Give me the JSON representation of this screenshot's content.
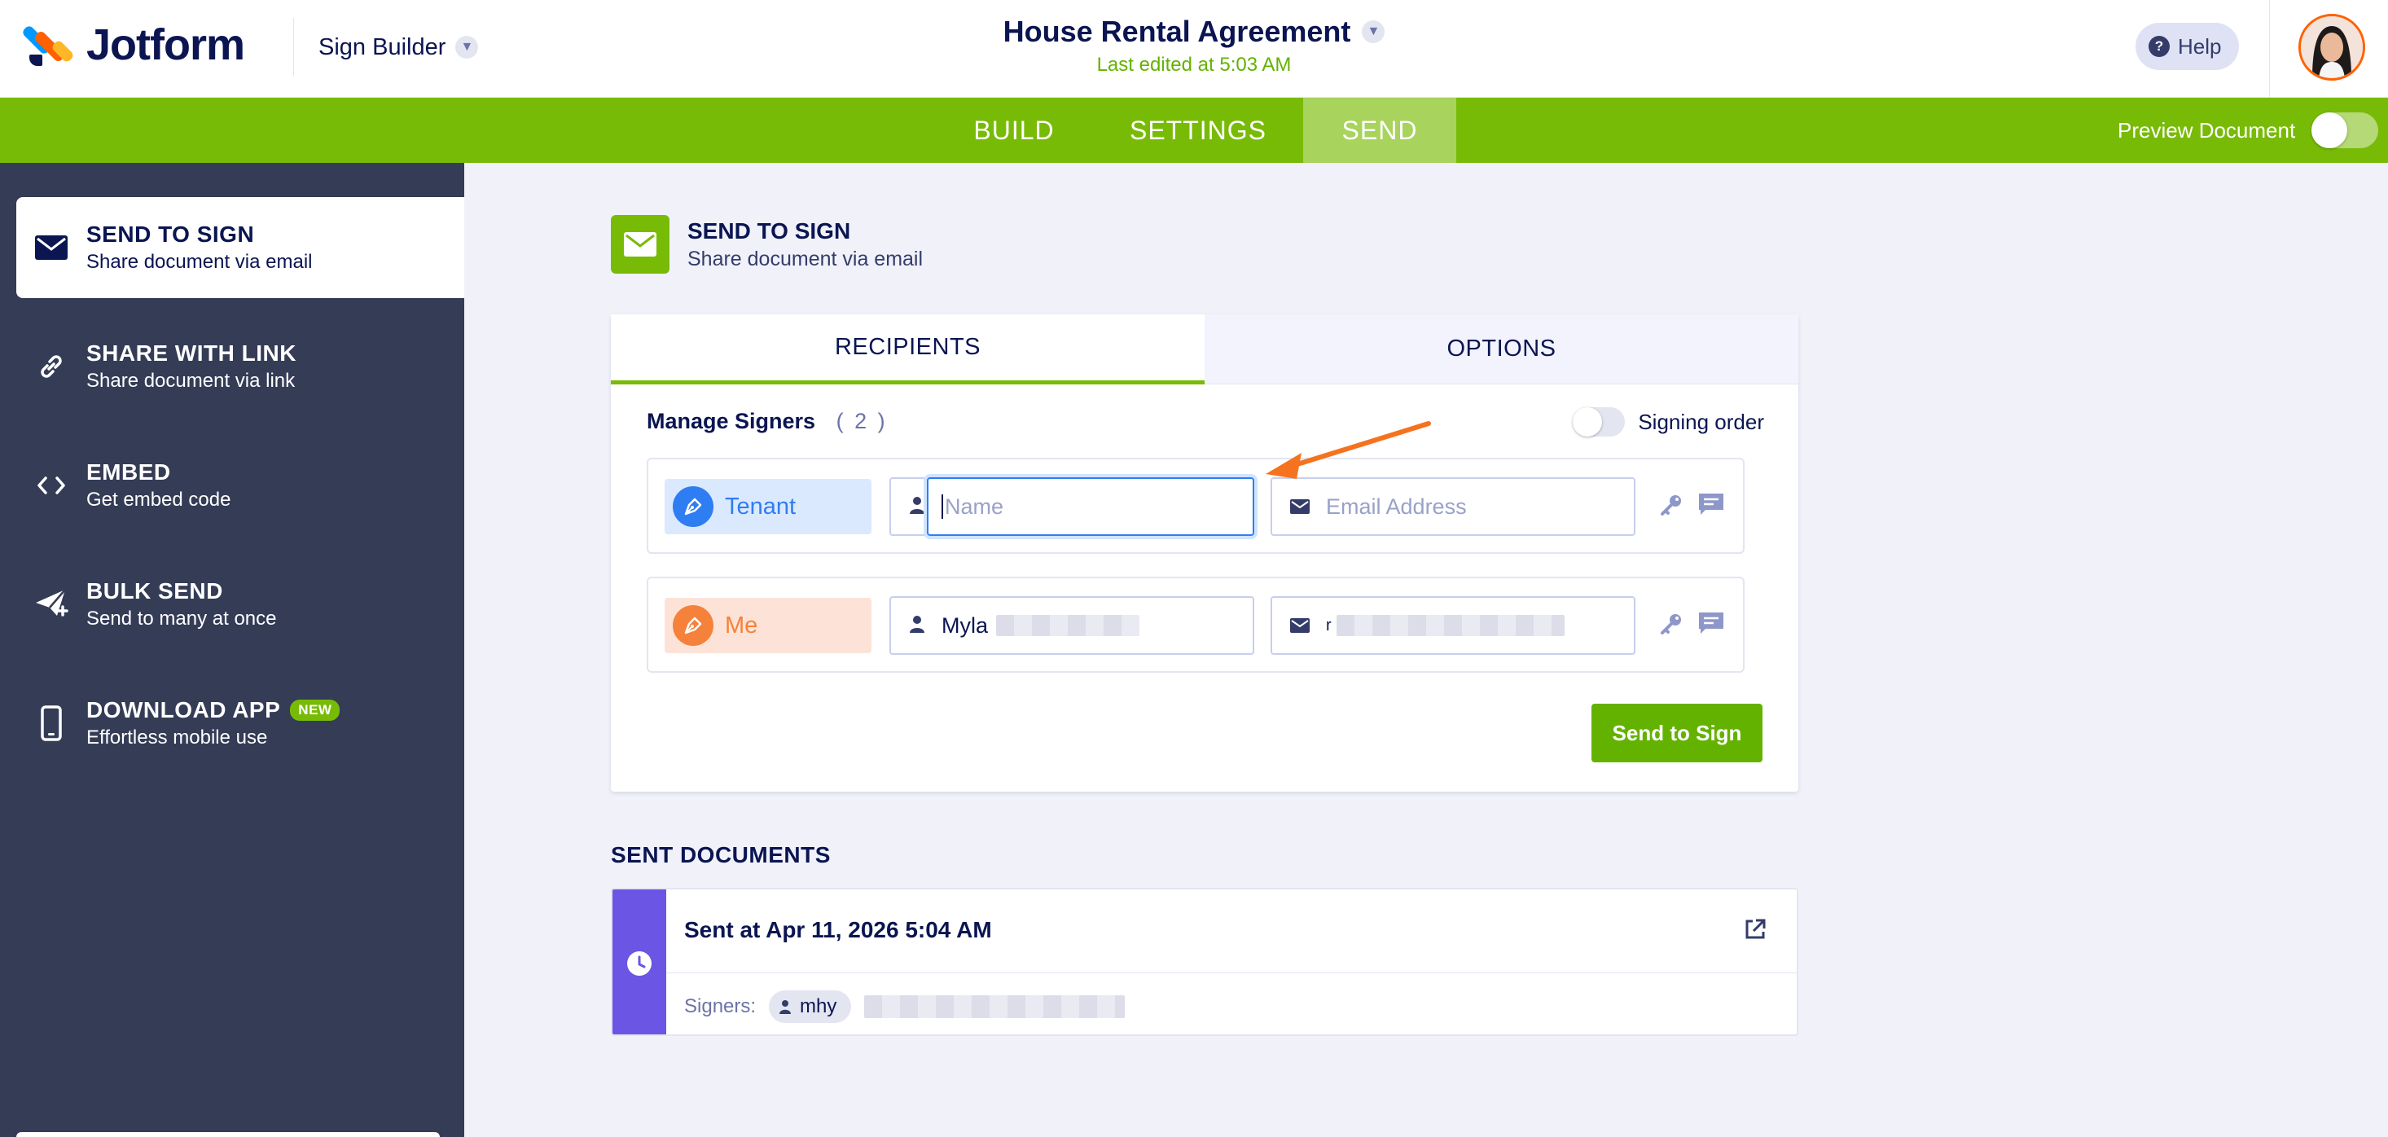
{
  "header": {
    "brand": "Jotform",
    "builder_label": "Sign Builder",
    "doc_title": "House Rental Agreement",
    "last_edited": "Last edited at 5:03 AM",
    "help_label": "Help"
  },
  "nav": {
    "tabs": [
      {
        "label": "BUILD"
      },
      {
        "label": "SETTINGS"
      },
      {
        "label": "SEND",
        "active": true
      }
    ],
    "preview_label": "Preview Document"
  },
  "sidebar": {
    "items": [
      {
        "title": "SEND TO SIGN",
        "sub": "Share document via email",
        "icon": "envelope-icon",
        "active": true
      },
      {
        "title": "SHARE WITH LINK",
        "sub": "Share document via link",
        "icon": "link-icon"
      },
      {
        "title": "EMBED",
        "sub": "Get embed code",
        "icon": "code-icon"
      },
      {
        "title": "BULK SEND",
        "sub": "Send to many at once",
        "icon": "paper-plane-icon"
      },
      {
        "title": "DOWNLOAD APP",
        "sub": "Effortless mobile use",
        "icon": "mobile-phone-icon",
        "badge": "NEW"
      }
    ]
  },
  "main": {
    "title": "SEND TO SIGN",
    "subtitle": "Share document via email",
    "tabs": {
      "recipients": "RECIPIENTS",
      "options": "OPTIONS"
    },
    "manage_label": "Manage Signers",
    "signer_count": "( 2 )",
    "signing_order_label": "Signing order",
    "signers": [
      {
        "role": "Tenant",
        "name_value": "",
        "name_placeholder": "Name",
        "email_value": "",
        "email_placeholder": "Email Address",
        "color": "#2e7df2",
        "bg": "#dbe9ff"
      },
      {
        "role": "Me",
        "name_value": "Myla",
        "name_placeholder": "Name",
        "email_value": "r",
        "email_placeholder": "Email Address",
        "color": "#f5813b",
        "bg": "#fde3d7"
      }
    ],
    "send_button": "Send to Sign"
  },
  "sent": {
    "title": "SENT DOCUMENTS",
    "date": "Sent at Apr 11, 2026 5:04 AM",
    "signers_label": "Signers:",
    "signer_chip": "mhy"
  },
  "colors": {
    "accent_green": "#78bb07",
    "sidebar_bg": "#343c56",
    "focus_blue": "#2e7df2",
    "annotation_arrow": "#f5731e",
    "history_strip": "#6a55e4"
  }
}
